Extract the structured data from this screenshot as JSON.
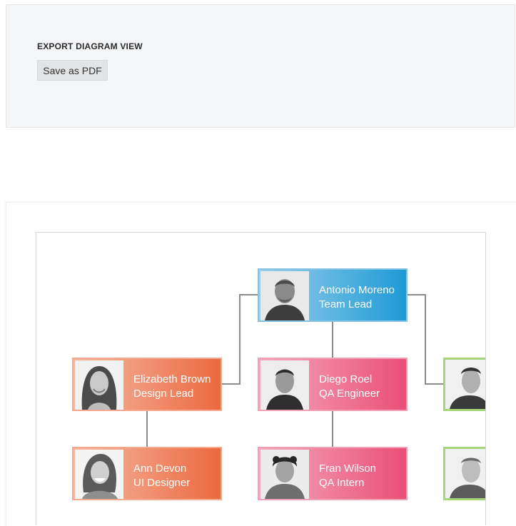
{
  "export": {
    "title": "EXPORT DIAGRAM VIEW",
    "button_label": "Save as PDF"
  },
  "diagram": {
    "nodes": [
      {
        "id": "antonio",
        "name": "Antonio Moreno",
        "role": "Team Lead",
        "color": "blue"
      },
      {
        "id": "elizabeth",
        "name": "Elizabeth Brown",
        "role": "Design Lead",
        "color": "orange"
      },
      {
        "id": "diego",
        "name": "Diego Roel",
        "role": "QA Engineer",
        "color": "pink"
      },
      {
        "id": "ann",
        "name": "Ann Devon",
        "role": "UI Designer",
        "color": "orange"
      },
      {
        "id": "fran",
        "name": "Fran Wilson",
        "role": "QA Intern",
        "color": "pink"
      },
      {
        "id": "partial1",
        "name": "",
        "role": "",
        "color": "green"
      },
      {
        "id": "partial2",
        "name": "",
        "role": "",
        "color": "green"
      }
    ]
  }
}
